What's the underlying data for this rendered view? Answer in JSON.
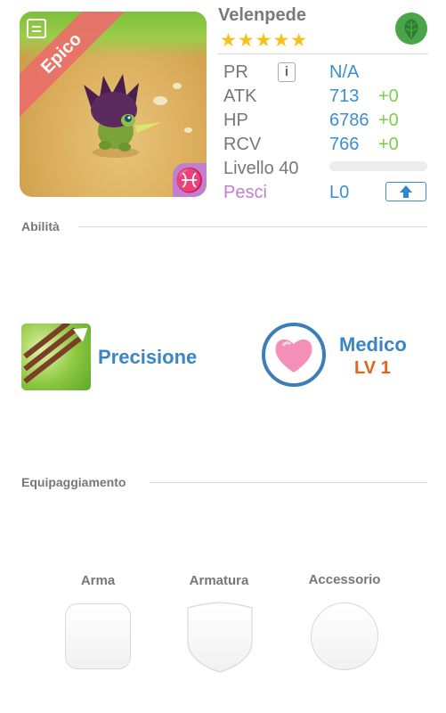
{
  "creature": {
    "name": "Velenpede",
    "stars": "★★★★★",
    "rarity": "Epico",
    "sign_symbol": "♓",
    "element_icon": "leaf-icon",
    "element_color": "#4aa54a"
  },
  "stats": {
    "pr": {
      "label": "PR",
      "value": "N/A"
    },
    "atk": {
      "label": "ATK",
      "value": "713",
      "bonus": "+0"
    },
    "hp": {
      "label": "HP",
      "value": "6786",
      "bonus": "+0"
    },
    "rcv": {
      "label": "RCV",
      "value": "766",
      "bonus": "+0"
    },
    "level": {
      "label": "Livello 40",
      "xp_fraction": 0
    },
    "sign": {
      "label": "Pesci",
      "value": "L0"
    }
  },
  "sections": {
    "abilities": "Abilità",
    "equipment": "Equipaggiamento"
  },
  "abilities": {
    "skill": {
      "name": "Precisione"
    },
    "passive": {
      "name": "Medico",
      "level": "LV 1"
    }
  },
  "equipment": {
    "weapon": "Arma",
    "armor": "Armatura",
    "accessory": "Accessorio"
  },
  "colors": {
    "accent_blue": "#3c8fcf",
    "bonus_green": "#7bcf4a",
    "rarity_red": "#e9706a",
    "sign_purple": "#c07fcf",
    "level_orange": "#e5621b",
    "star_gold": "#f5c11a"
  }
}
